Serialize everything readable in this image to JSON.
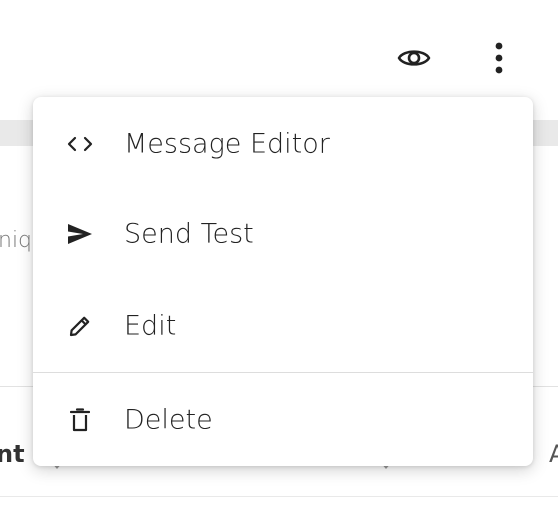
{
  "background": {
    "partial_text": "niqu",
    "column_left": "nt",
    "column_right": "A"
  },
  "menu": {
    "items": [
      {
        "label": "Message Editor",
        "icon": "code-icon"
      },
      {
        "label": "Send Test",
        "icon": "send-icon"
      },
      {
        "label": "Edit",
        "icon": "pencil-icon"
      },
      {
        "label": "Delete",
        "icon": "trash-icon"
      }
    ]
  },
  "header": {
    "icons": [
      "eye-icon",
      "more-vertical-icon"
    ]
  }
}
